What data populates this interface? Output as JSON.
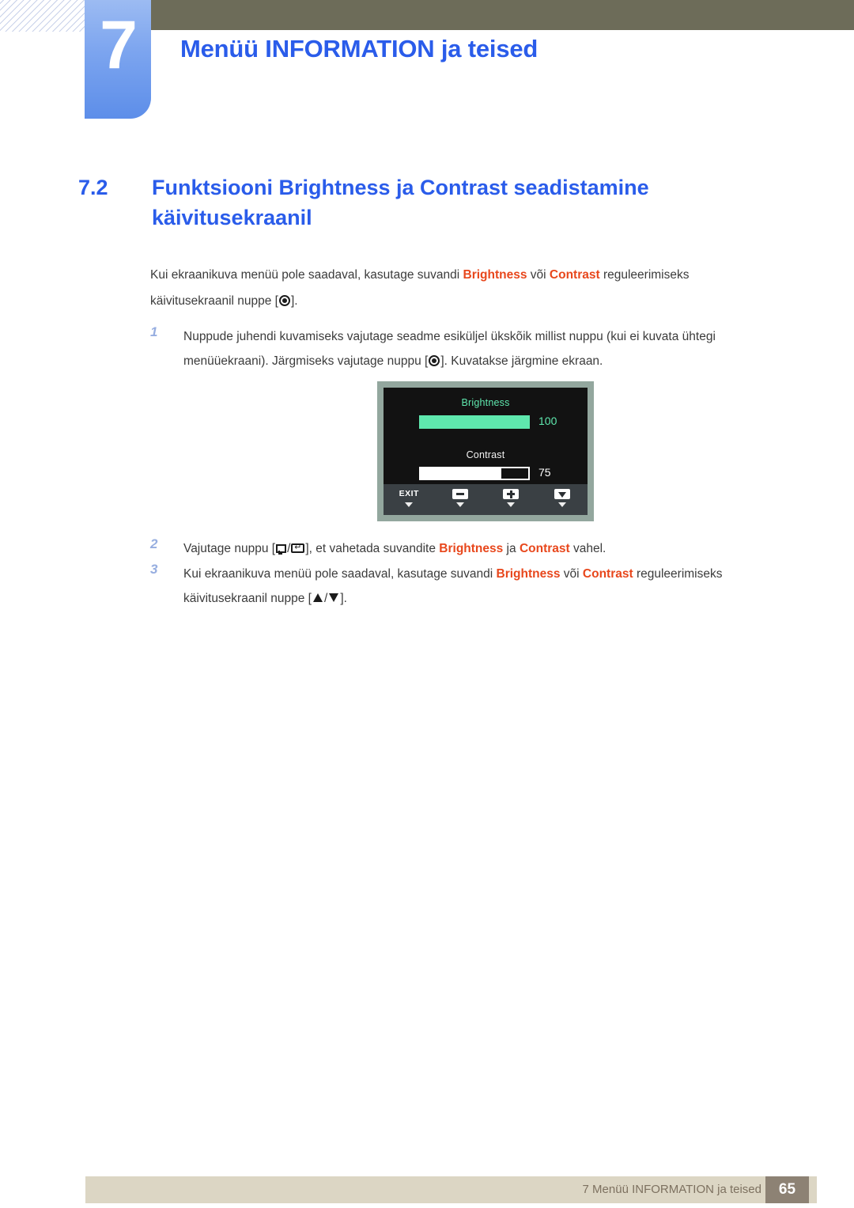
{
  "header": {
    "chapter_number": "7",
    "chapter_title": "Menüü INFORMATION ja teised",
    "band_color": "#6d6c59",
    "tab_color": "#7ba4ef",
    "title_color": "#2a5cea"
  },
  "section": {
    "number": "7.2",
    "title": "Funktsiooni Brightness ja Contrast seadistamine käivitusekraanil"
  },
  "intro": {
    "part1": "Kui ekraanikuva menüü pole saadaval, kasutage suvandi ",
    "kw1": "Brightness",
    "part2": " või ",
    "kw2": "Contrast",
    "part3": " reguleerimiseks",
    "line2_pre": "käivitusekraanil nuppe [",
    "line2_post": "]."
  },
  "steps": [
    {
      "number": "1",
      "part1": "Nuppude juhendi kuvamiseks vajutage seadme esiküljel ükskõik millist nuppu (kui ei kuvata ühtegi",
      "part2": "menüüekraani). Järgmiseks vajutage nuppu [",
      "part3": "]. Kuvatakse järgmine ekraan."
    },
    {
      "number": "2",
      "part1": "Vajutage nuppu [",
      "sep": "/",
      "part2": "], et vahetada suvandite ",
      "kw1": "Brightness",
      "part3": " ja ",
      "kw2": "Contrast",
      "part4": " vahel."
    },
    {
      "number": "3",
      "part1": "Kui ekraanikuva menüü pole saadaval, kasutage suvandi ",
      "kw1": "Brightness",
      "part2": " või ",
      "kw2": "Contrast",
      "part3": " reguleerimiseks",
      "line2_pre": "käivitusekraanil nuppe [",
      "line2_sep": "/",
      "line2_post": "]."
    }
  ],
  "osd": {
    "brightness_label": "Brightness",
    "brightness_value": "100",
    "brightness_percent": 100,
    "brightness_color": "#5fe8ae",
    "contrast_label": "Contrast",
    "contrast_value": "75",
    "contrast_percent": 75,
    "contrast_color": "#ffffff",
    "screen_color": "#121212",
    "bezel_color": "#93a79e",
    "keybar_color": "#3a4044",
    "keys": [
      {
        "label": "EXIT",
        "icon": ""
      },
      {
        "label": "",
        "icon": "minus-icon"
      },
      {
        "label": "",
        "icon": "plus-icon"
      },
      {
        "label": "",
        "icon": "down-triangle-icon"
      }
    ]
  },
  "footer": {
    "text": "7 Menüü INFORMATION ja teised",
    "page": "65",
    "bar_color": "#dcd6c4",
    "page_box_color": "#8d8274"
  }
}
